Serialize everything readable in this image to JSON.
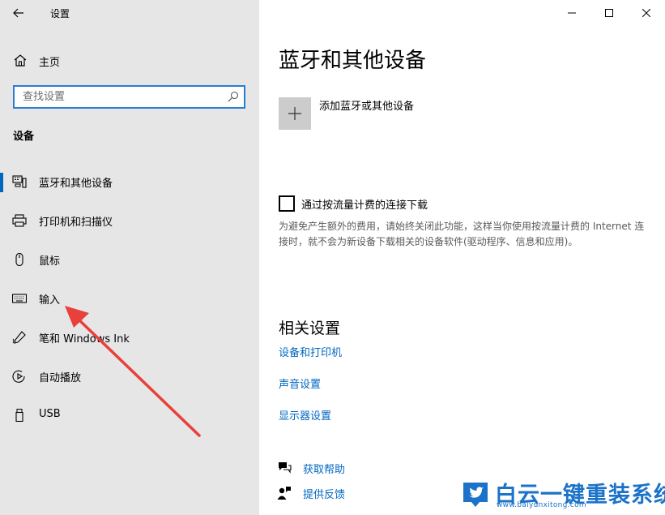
{
  "app": {
    "title": "设置"
  },
  "sidebar": {
    "home_label": "主页",
    "search_placeholder": "查找设置",
    "section_title": "设备",
    "items": [
      {
        "label": "蓝牙和其他设备",
        "icon": "bluetooth-device-icon",
        "active": true
      },
      {
        "label": "打印机和扫描仪",
        "icon": "printer-icon",
        "active": false
      },
      {
        "label": "鼠标",
        "icon": "mouse-icon",
        "active": false
      },
      {
        "label": "输入",
        "icon": "keyboard-icon",
        "active": false
      },
      {
        "label": "笔和 Windows Ink",
        "icon": "pen-icon",
        "active": false
      },
      {
        "label": "自动播放",
        "icon": "autoplay-icon",
        "active": false
      },
      {
        "label": "USB",
        "icon": "usb-icon",
        "active": false
      }
    ]
  },
  "main": {
    "page_title": "蓝牙和其他设备",
    "add_device_label": "添加蓝牙或其他设备",
    "metered": {
      "label": "通过按流量计费的连接下载",
      "checked": false,
      "description": "为避免产生额外的费用，请始终关闭此功能，这样当你使用按流量计费的 Internet 连接时，就不会为新设备下载相关的设备软件(驱动程序、信息和应用)。"
    },
    "related": {
      "title": "相关设置",
      "links": [
        "设备和打印机",
        "声音设置",
        "显示器设置"
      ]
    },
    "help": {
      "get_help": "获取帮助",
      "feedback": "提供反馈"
    }
  },
  "watermark": {
    "text": "白云一键重装系统",
    "url": "www.baiyunxitong.com"
  },
  "colors": {
    "accent": "#0067c0",
    "sidebar_bg": "#e6e6e6",
    "arrow": "#e8403a",
    "watermark": "#1a73c8"
  }
}
